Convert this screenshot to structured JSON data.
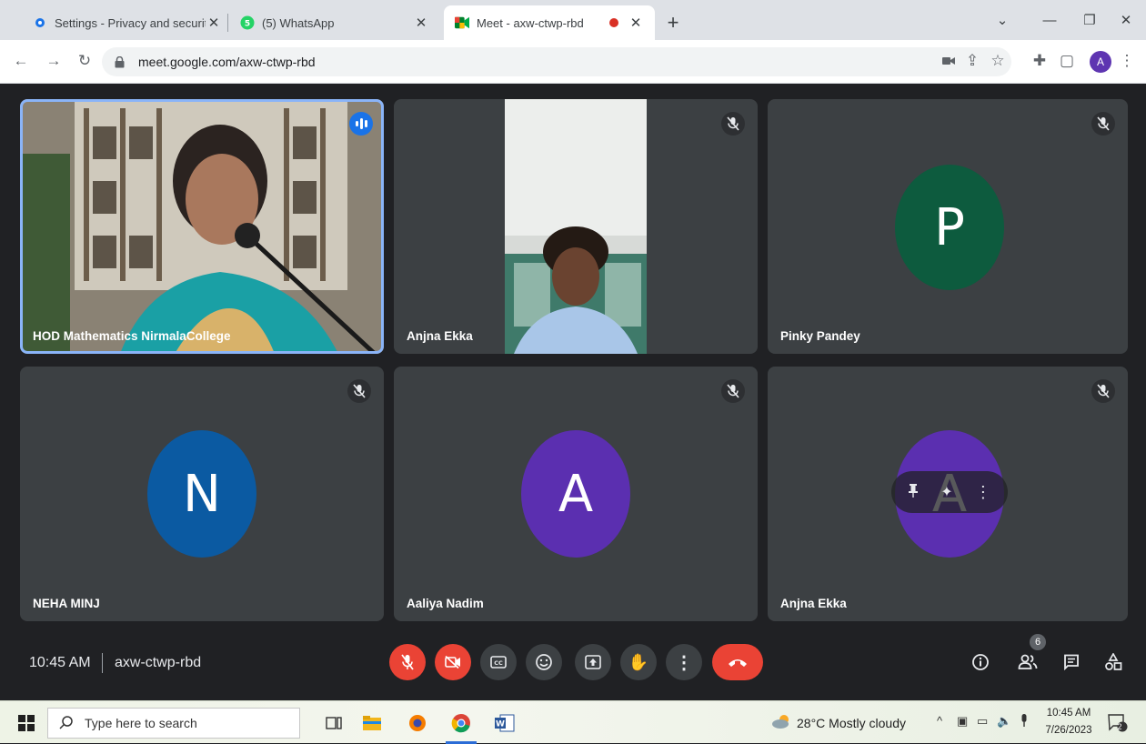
{
  "browser": {
    "tabs": [
      {
        "title": "Settings - Privacy and security",
        "favicon": "gear-icon",
        "active": false
      },
      {
        "title": "(5) WhatsApp",
        "favicon": "whatsapp-icon",
        "active": false
      },
      {
        "title": "Meet - axw-ctwp-rbd",
        "favicon": "meet-icon",
        "active": true
      }
    ],
    "address": "meet.google.com/axw-ctwp-rbd",
    "profile_initial": "A"
  },
  "meet": {
    "tiles": [
      {
        "name": "HOD Mathematics NirmalaCollege",
        "kind": "video",
        "speaking": true
      },
      {
        "name": "Anjna Ekka",
        "kind": "video",
        "muted": true
      },
      {
        "name": "Pinky Pandey",
        "initial": "P",
        "color": "#0d5b3e",
        "muted": true
      },
      {
        "name": "NEHA MINJ",
        "initial": "N",
        "color": "#0b5aa2",
        "muted": true
      },
      {
        "name": "Aaliya Nadim",
        "initial": "A",
        "color": "#5b2fb0",
        "muted": true
      },
      {
        "name": "Anjna Ekka",
        "initial": "A",
        "color": "#5b2fb0",
        "muted": true
      }
    ],
    "time": "10:45 AM",
    "meeting_code": "axw-ctwp-rbd",
    "participant_count": "6"
  },
  "taskbar": {
    "search_placeholder": "Type here to search",
    "weather": "28°C  Mostly cloudy",
    "time": "10:45 AM",
    "date": "7/26/2023",
    "notification_count": "2"
  },
  "colors": {
    "meet_bg": "#202124",
    "tile_bg": "#3c4043",
    "red": "#ea4335",
    "speaking_blue": "#1a73e8"
  }
}
